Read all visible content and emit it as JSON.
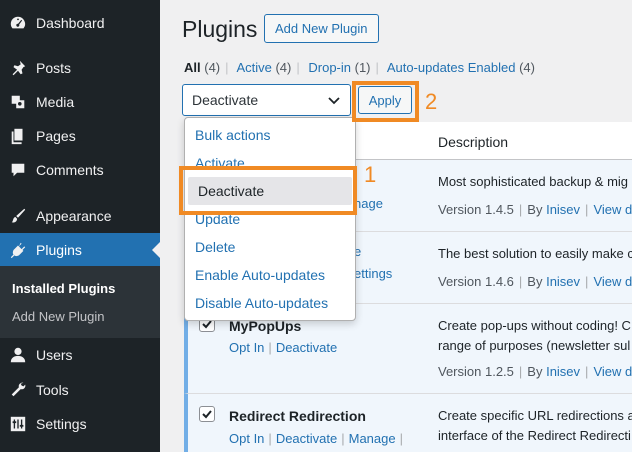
{
  "sidebar": {
    "items": [
      {
        "label": "Dashboard"
      },
      {
        "label": "Posts"
      },
      {
        "label": "Media"
      },
      {
        "label": "Pages"
      },
      {
        "label": "Comments"
      },
      {
        "label": "Appearance"
      },
      {
        "label": "Plugins"
      },
      {
        "label": "Users"
      },
      {
        "label": "Tools"
      },
      {
        "label": "Settings"
      }
    ],
    "submenu": [
      "Installed Plugins",
      "Add New Plugin"
    ]
  },
  "header": {
    "title": "Plugins",
    "add_new": "Add New Plugin"
  },
  "filters": {
    "all": "All",
    "all_count": "(4)",
    "active": "Active",
    "active_count": "(4)",
    "dropin": "Drop-in",
    "dropin_count": "(1)",
    "autoupdates": "Auto-updates Enabled",
    "autoupdates_count": "(4)"
  },
  "bulk": {
    "selected": "Deactivate",
    "apply": "Apply"
  },
  "dropdown": {
    "options": [
      "Bulk actions",
      "Activate",
      "Deactivate",
      "Update",
      "Delete",
      "Enable Auto-updates",
      "Disable Auto-updates"
    ]
  },
  "table": {
    "col_description": "Description",
    "rows": [
      {
        "action_tail": "Manage",
        "desc1": "Most sophisticated backup & mig",
        "version": "Version 1.4.5",
        "by": "By",
        "author": "Inisev",
        "view": "View det"
      },
      {
        "action_tail": "ettings",
        "action_dot": "e",
        "desc1": "The best solution to easily make c",
        "version": "Version 1.4.6",
        "by": "By",
        "author": "Inisev",
        "view": "View det"
      },
      {
        "name": "MyPopUps",
        "action1": "Opt In",
        "action2": "Deactivate",
        "desc1": "Create pop-ups without coding! C",
        "desc2": "range of purposes (newsletter sul",
        "version": "Version 1.2.5",
        "by": "By",
        "author": "Inisev",
        "view": "View det"
      },
      {
        "name": "Redirect Redirection",
        "action1": "Opt In",
        "action2": "Deactivate",
        "action3": "Manage",
        "desc1": "Create specific URL redirections a",
        "desc2": "interface of the Redirect Redirecti"
      }
    ]
  },
  "annotations": {
    "one": "1",
    "two": "2"
  },
  "colors": {
    "accent": "#2271b1",
    "sidebar": "#1d2327",
    "annotation": "#f08a24"
  }
}
